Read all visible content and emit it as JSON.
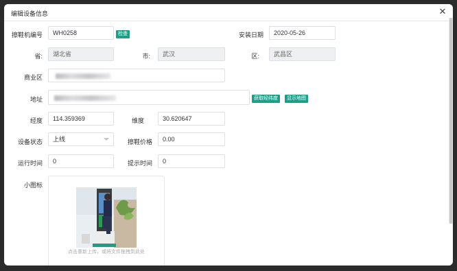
{
  "dialog": {
    "title": "编辑设备信息",
    "close_icon": "close-icon"
  },
  "form": {
    "device_no": {
      "label": "擦鞋机编号",
      "value": "WH0258",
      "check_btn": "检查"
    },
    "install_date": {
      "label": "安装日期",
      "value": "2020-05-26"
    },
    "province": {
      "label": "省:",
      "value": "湖北省"
    },
    "city": {
      "label": "市:",
      "value": "武汉"
    },
    "district": {
      "label": "区:",
      "value": "武昌区"
    },
    "business_area": {
      "label": "商业区",
      "value": ""
    },
    "address": {
      "label": "地址",
      "value": "",
      "get_coords_btn": "获取经纬度",
      "show_map_btn": "显示地图"
    },
    "longitude": {
      "label": "经度",
      "value": "114.359369"
    },
    "latitude": {
      "label": "维度",
      "value": "30.620647"
    },
    "status": {
      "label": "设备状态",
      "value": "上线"
    },
    "price": {
      "label": "擦鞋价格",
      "value": "0.00"
    },
    "run_time": {
      "label": "运行时间",
      "value": "0"
    },
    "remind_time": {
      "label": "提示时间",
      "value": "0"
    },
    "icon": {
      "label": "小图标",
      "hint": "点击重新上传，或将文件拖拽到此处"
    }
  },
  "colors": {
    "accent": "#1e9e86"
  }
}
